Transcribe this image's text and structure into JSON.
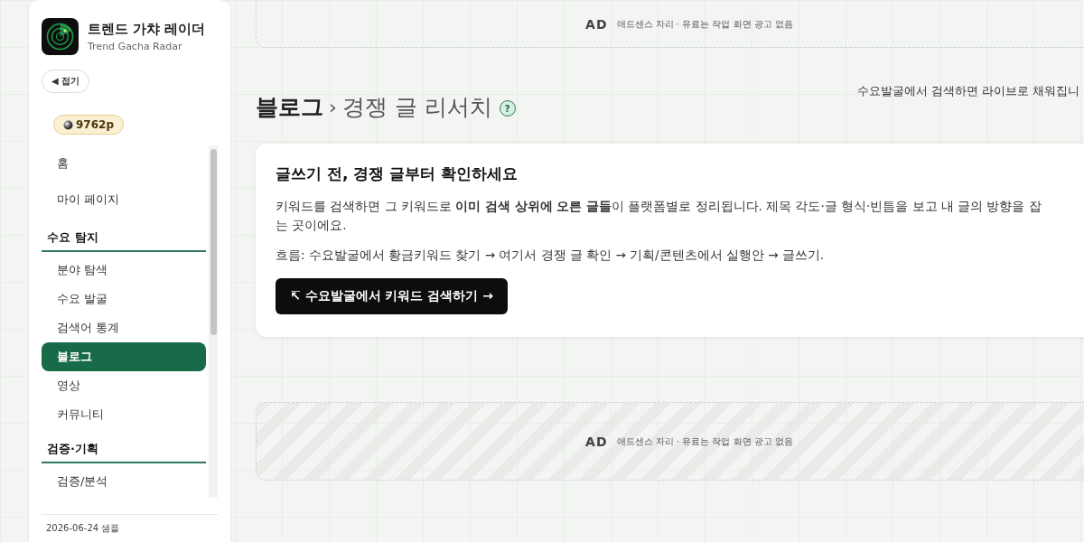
{
  "brand": {
    "title": "트렌드 가챠 레이더",
    "subtitle": "Trend Gacha Radar"
  },
  "collapse_button": "◀ 접기",
  "points": "9762p",
  "nav": [
    {
      "kind": "item",
      "label": "홈",
      "selected": false
    },
    {
      "kind": "item",
      "label": "마이 페이지",
      "selected": false
    },
    {
      "kind": "section",
      "label": "수요 탐지"
    },
    {
      "kind": "item",
      "label": "분야 탐색",
      "selected": false
    },
    {
      "kind": "item",
      "label": "수요 발굴",
      "selected": false
    },
    {
      "kind": "item",
      "label": "검색어 통계",
      "selected": false
    },
    {
      "kind": "item",
      "label": "블로그",
      "selected": true
    },
    {
      "kind": "item",
      "label": "영상",
      "selected": false
    },
    {
      "kind": "item",
      "label": "커뮤니티",
      "selected": false
    },
    {
      "kind": "section",
      "label": "검증·기획"
    },
    {
      "kind": "item",
      "label": "검증/분석",
      "selected": false
    }
  ],
  "sidebar_footer": "2026-06-24 샘플",
  "ads": [
    {
      "badge": "AD",
      "text": "애드센스 자리 · 유료는 작업 화면 광고 없음",
      "striped": false
    },
    {
      "badge": "AD",
      "text": "애드센스 자리 · 유료는 작업 화면 광고 없음",
      "striped": true
    }
  ],
  "page": {
    "breadcrumb": "블로그",
    "separator": "›",
    "title": "경쟁 글 리서치",
    "help": "?",
    "note": "수요발굴에서 검색하면 라이브로 채워집니"
  },
  "card": {
    "title": "글쓰기 전, 경쟁 글부터 확인하세요",
    "body": "키워드를 검색하면 그 키워드로 **이미 검색 상위에 오른 글들**이 플랫폼별로 정리됩니다. 제목 각도·글 형식·빈틈을 보고 내 글의 방향을 잡는 곳이에요.",
    "flow": "흐름: 수요발굴에서 황금키워드 찾기 → 여기서 경쟁 글 확인 → 기획/콘텐츠에서 실행안 → 글쓰기.",
    "button": "↸ 수요발굴에서 키워드 검색하기 →"
  }
}
